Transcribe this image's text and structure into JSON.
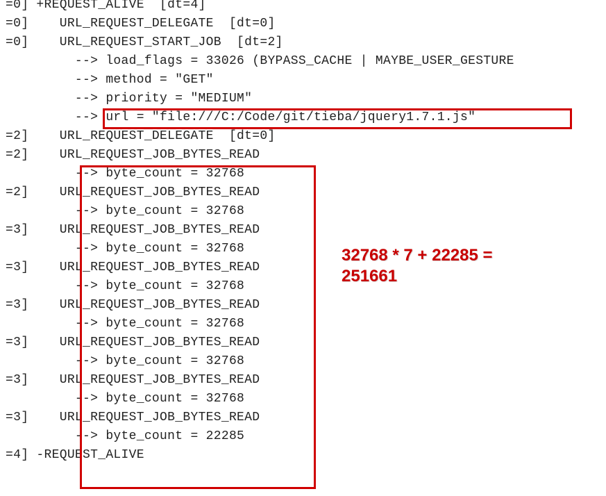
{
  "log": {
    "lines": [
      "=0] +REQUEST_ALIVE  [dt=4]",
      "=0]    URL_REQUEST_DELEGATE  [dt=0]",
      "=0]    URL_REQUEST_START_JOB  [dt=2]",
      "         --> load_flags = 33026 (BYPASS_CACHE | MAYBE_USER_GESTURE",
      "         --> method = \"GET\"",
      "         --> priority = \"MEDIUM\"",
      "         --> url = \"file:///C:/Code/git/tieba/jquery1.7.1.js\"",
      "=2]    URL_REQUEST_DELEGATE  [dt=0]",
      "=2]    URL_REQUEST_JOB_BYTES_READ",
      "         --> byte_count = 32768",
      "=2]    URL_REQUEST_JOB_BYTES_READ",
      "         --> byte_count = 32768",
      "=3]    URL_REQUEST_JOB_BYTES_READ",
      "         --> byte_count = 32768",
      "=3]    URL_REQUEST_JOB_BYTES_READ",
      "         --> byte_count = 32768",
      "=3]    URL_REQUEST_JOB_BYTES_READ",
      "         --> byte_count = 32768",
      "=3]    URL_REQUEST_JOB_BYTES_READ",
      "         --> byte_count = 32768",
      "=3]    URL_REQUEST_JOB_BYTES_READ",
      "         --> byte_count = 32768",
      "=3]    URL_REQUEST_JOB_BYTES_READ",
      "         --> byte_count = 22285",
      "=4] -REQUEST_ALIVE"
    ]
  },
  "annotation": {
    "line1": "32768 * 7 + 22285 =",
    "line2": "251661"
  }
}
